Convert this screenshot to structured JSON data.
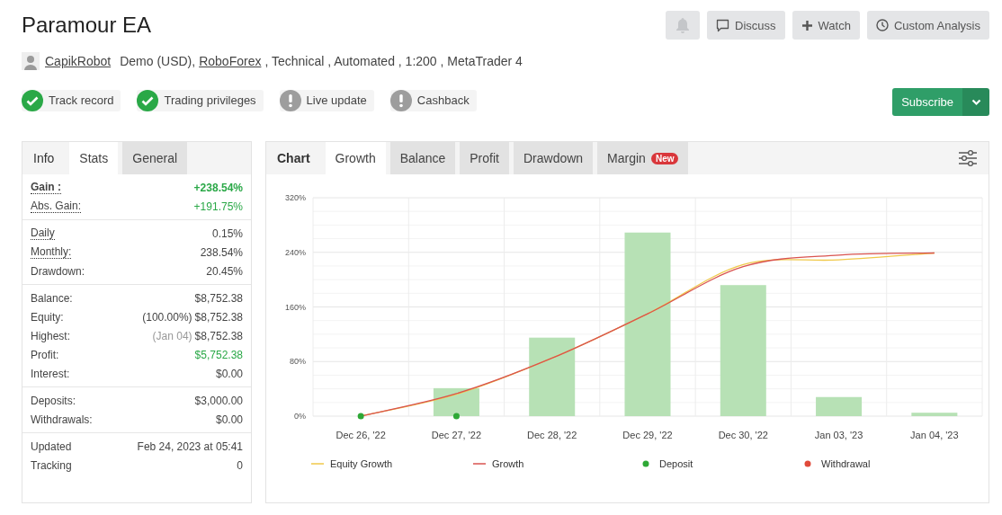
{
  "title": "Paramour EA",
  "header_buttons": [
    {
      "kind": "bell"
    },
    {
      "kind": "comment",
      "label": "Discuss"
    },
    {
      "kind": "plus",
      "label": "Watch"
    },
    {
      "kind": "clock",
      "label": "Custom Analysis"
    }
  ],
  "info_line": {
    "user": "CapikRobot",
    "parts": [
      {
        "text": "Demo (USD),",
        "link": false
      },
      {
        "text": "RoboForex",
        "link": true
      },
      {
        "text": ", Technical , Automated , 1:200 , MetaTrader 4",
        "link": false
      }
    ]
  },
  "badges": [
    {
      "label": "Track record",
      "verified": true
    },
    {
      "label": "Trading privileges",
      "verified": true
    },
    {
      "label": "Live update",
      "verified": false
    },
    {
      "label": "Cashback",
      "verified": false
    }
  ],
  "subscribe": {
    "label": "Subscribe"
  },
  "stats_panel": {
    "heading": "Info",
    "tabs": [
      {
        "label": "Stats",
        "selected": true
      },
      {
        "label": "General",
        "selected": false
      }
    ],
    "groups": [
      [
        {
          "label": "Gain :",
          "value": "+238.54%",
          "bold": true,
          "dotted": true,
          "positive": true
        },
        {
          "label": "Abs. Gain:",
          "value": "+191.75%",
          "bold": false,
          "dotted": true,
          "positive": true
        }
      ],
      [
        {
          "label": "Daily",
          "value": "0.15%",
          "bold": false,
          "dotted": true,
          "positive": false
        },
        {
          "label": "Monthly:",
          "value": "238.54%",
          "bold": false,
          "dotted": true,
          "positive": false
        },
        {
          "label": "Drawdown:",
          "value": "20.45%",
          "bold": false,
          "dotted": false,
          "positive": false
        }
      ],
      [
        {
          "label": "Balance:",
          "value": "$8,752.38",
          "bold": false,
          "dotted": false,
          "positive": false
        },
        {
          "label": "Equity:",
          "note": "(100.00%)",
          "note_muted": false,
          "value": "$8,752.38",
          "bold": false,
          "dotted": false,
          "positive": false
        },
        {
          "label": "Highest:",
          "note": "(Jan 04)",
          "note_muted": true,
          "value": "$8,752.38",
          "bold": false,
          "dotted": false,
          "positive": false
        },
        {
          "label": "Profit:",
          "value": "$5,752.38",
          "bold": false,
          "dotted": false,
          "positive": true
        },
        {
          "label": "Interest:",
          "value": "$0.00",
          "bold": false,
          "dotted": false,
          "positive": false
        }
      ],
      [
        {
          "label": "Deposits:",
          "value": "$3,000.00",
          "bold": false,
          "dotted": false,
          "positive": false
        },
        {
          "label": "Withdrawals:",
          "value": "$0.00",
          "bold": false,
          "dotted": false,
          "positive": false
        }
      ],
      [
        {
          "label": "Updated",
          "value": "Feb 24, 2023 at 05:41",
          "bold": false,
          "dotted": false,
          "positive": false
        },
        {
          "label": "Tracking",
          "value": "0",
          "bold": false,
          "dotted": false,
          "positive": false
        }
      ]
    ]
  },
  "chart_panel": {
    "heading": "Chart",
    "tabs": [
      {
        "label": "Growth",
        "selected": true
      },
      {
        "label": "Balance",
        "selected": false
      },
      {
        "label": "Profit",
        "selected": false
      },
      {
        "label": "Drawdown",
        "selected": false
      },
      {
        "label": "Margin",
        "selected": false,
        "badge": "New"
      }
    ],
    "chart_data": {
      "type": "line",
      "categories": [
        "Dec 26, '22",
        "Dec 27, '22",
        "Dec 28, '22",
        "Dec 29, '22",
        "Dec 30, '22",
        "Jan 03, '23",
        "Jan 04, '23"
      ],
      "grid": true,
      "legend": true,
      "ylim": [
        0,
        320
      ],
      "yticks": [
        {
          "value": 0,
          "label": "0%"
        },
        {
          "value": 80,
          "label": "80%"
        },
        {
          "value": 160,
          "label": "160%"
        },
        {
          "value": 240,
          "label": "240%"
        },
        {
          "value": 320,
          "label": "320%"
        }
      ],
      "series": [
        {
          "type": "bar",
          "color": "#b7e1b5",
          "values": [
            0,
            41,
            115,
            269,
            192,
            28,
            5
          ]
        },
        {
          "name": "Equity Growth",
          "color": "#f0c94a",
          "values": [
            0,
            32,
            85,
            150,
            222,
            229,
            239
          ]
        },
        {
          "name": "Growth",
          "color": "#d9534f",
          "values": [
            0,
            33,
            85,
            150,
            219,
            236,
            239
          ]
        },
        {
          "type": "scatter",
          "name": "Deposit",
          "color": "#2ea836",
          "values": [
            0,
            0,
            null,
            null,
            null,
            null,
            null
          ]
        },
        {
          "type": "scatter",
          "name": "Withdrawal",
          "color": "#e04a3a",
          "values": [
            null,
            null,
            null,
            null,
            null,
            null,
            null
          ]
        }
      ]
    }
  }
}
